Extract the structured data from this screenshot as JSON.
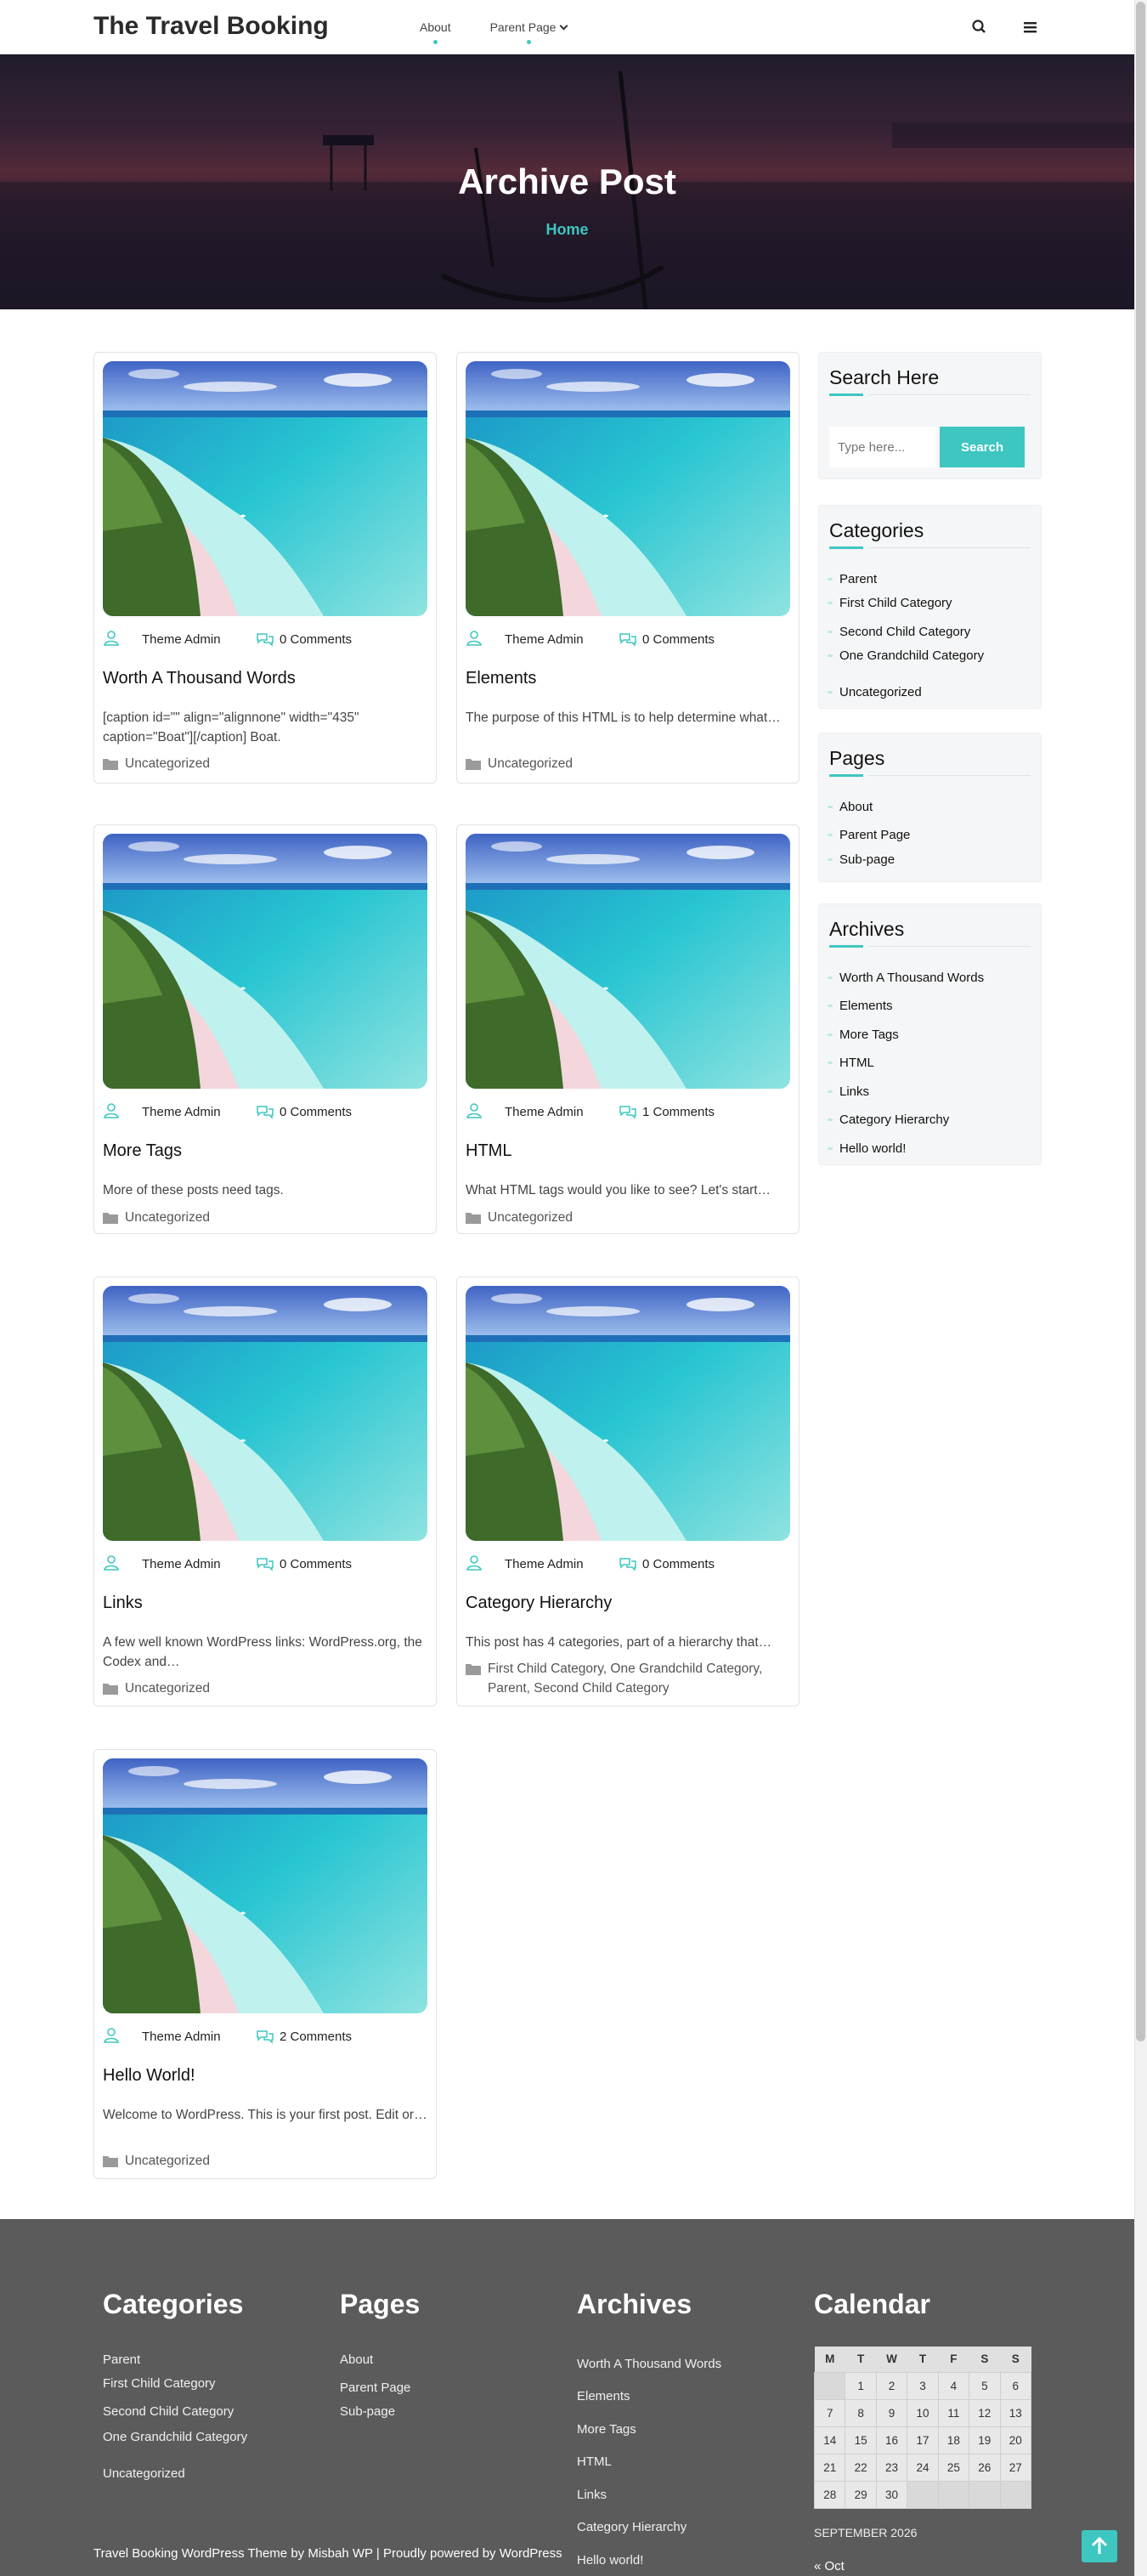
{
  "header": {
    "logo": "The Travel Booking",
    "nav": [
      {
        "label": "About"
      },
      {
        "label": "Parent Page"
      }
    ],
    "search_icon": "search-icon",
    "menu_icon": "hamburger-menu-icon"
  },
  "hero": {
    "title": "Archive Post",
    "breadcrumb": "Home"
  },
  "posts": [
    {
      "author": "Theme Admin",
      "comments": "0 Comments",
      "title": "Worth A Thousand Words",
      "excerpt": "[caption id=\"\" align=\"alignnone\" width=\"435\" caption=\"Boat\"][/caption] Boat.",
      "categories": "Uncategorized"
    },
    {
      "author": "Theme Admin",
      "comments": "0 Comments",
      "title": "Elements",
      "excerpt": "The purpose of this HTML is to help determine what…",
      "categories": "Uncategorized"
    },
    {
      "author": "Theme Admin",
      "comments": "0 Comments",
      "title": "More Tags",
      "excerpt": "More of these posts need tags.",
      "categories": "Uncategorized"
    },
    {
      "author": "Theme Admin",
      "comments": "1 Comments",
      "title": "HTML",
      "excerpt": "What HTML tags would you like to see? Let's start…",
      "categories": "Uncategorized"
    },
    {
      "author": "Theme Admin",
      "comments": "0 Comments",
      "title": "Links",
      "excerpt": "A few well known WordPress links: WordPress.org, the Codex and…",
      "categories": "Uncategorized"
    },
    {
      "author": "Theme Admin",
      "comments": "0 Comments",
      "title": "Category Hierarchy",
      "excerpt": "This post has 4 categories, part of a hierarchy that…",
      "categories": "First Child Category, One Grandchild Category, Parent, Second Child Category"
    },
    {
      "author": "Theme Admin",
      "comments": "2 Comments",
      "title": "Hello World!",
      "excerpt": "Welcome to WordPress. This is your first post. Edit or…",
      "categories": "Uncategorized"
    }
  ],
  "sidebar": {
    "search": {
      "title": "Search Here",
      "placeholder": "Type here...",
      "button": "Search"
    },
    "categories": {
      "title": "Categories",
      "items": [
        "Parent",
        "First Child Category",
        "Second Child Category",
        "One Grandchild Category",
        "Uncategorized"
      ]
    },
    "pages": {
      "title": "Pages",
      "items": [
        "About",
        "Parent Page",
        "Sub-page"
      ]
    },
    "archives": {
      "title": "Archives",
      "items": [
        "Worth A Thousand Words",
        "Elements",
        "More Tags",
        "HTML",
        "Links",
        "Category Hierarchy",
        "Hello world!"
      ]
    }
  },
  "footer": {
    "categories": {
      "title": "Categories",
      "items": [
        "Parent",
        "First Child Category",
        "Second Child Category",
        "One Grandchild Category",
        "Uncategorized"
      ]
    },
    "pages": {
      "title": "Pages",
      "items": [
        "About",
        "Parent Page",
        "Sub-page"
      ]
    },
    "archives": {
      "title": "Archives",
      "items": [
        "Worth A Thousand Words",
        "Elements",
        "More Tags",
        "HTML",
        "Links",
        "Category Hierarchy",
        "Hello world!"
      ]
    },
    "calendar": {
      "title": "Calendar",
      "days": [
        "M",
        "T",
        "W",
        "T",
        "F",
        "S",
        "S"
      ],
      "rows": [
        [
          "",
          "1",
          "2",
          "3",
          "4",
          "5",
          "6"
        ],
        [
          "7",
          "8",
          "9",
          "10",
          "11",
          "12",
          "13"
        ],
        [
          "14",
          "15",
          "16",
          "17",
          "18",
          "19",
          "20"
        ],
        [
          "21",
          "22",
          "23",
          "24",
          "25",
          "26",
          "27"
        ],
        [
          "28",
          "29",
          "30",
          "",
          "",
          "",
          ""
        ]
      ],
      "caption": "SEPTEMBER 2026",
      "prev": "« Oct"
    },
    "copyright": "Travel Booking WordPress Theme by Misbah WP | Proudly powered by WordPress"
  },
  "colors": {
    "accent": "#3ec6c0",
    "footer_bg": "#5b5b5b"
  }
}
